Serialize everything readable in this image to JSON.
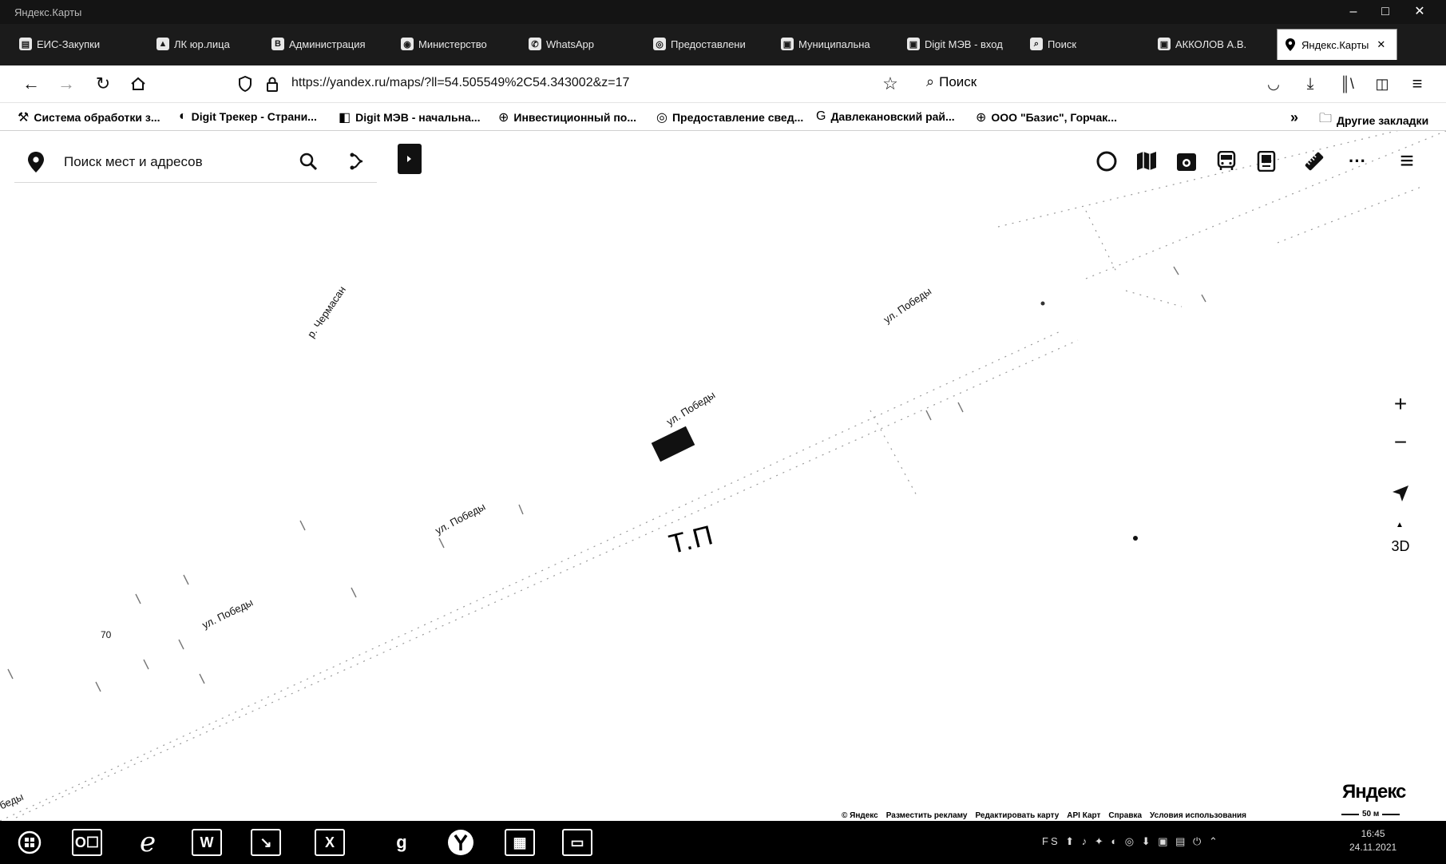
{
  "window": {
    "title": "Яндекс.Карты",
    "controls": [
      "–",
      "□",
      "✕"
    ]
  },
  "tabs": [
    {
      "label": "ЕИС-Закупки",
      "icon": "doc-icon"
    },
    {
      "label": "ЛК юр.лица",
      "icon": "doc-icon"
    },
    {
      "label": "Администрация",
      "icon": "vk-icon"
    },
    {
      "label": "Министерство",
      "icon": "globe-icon"
    },
    {
      "label": "WhatsApp",
      "icon": "whatsapp-icon"
    },
    {
      "label": "Предоставлени",
      "icon": "globe-icon"
    },
    {
      "label": "Муниципальна",
      "icon": "doc-icon"
    },
    {
      "label": "Digit МЭВ - вход",
      "icon": "doc-icon"
    },
    {
      "label": "Поиск",
      "icon": "search-icon"
    },
    {
      "label": "АККОЛОВ А.В.",
      "icon": "doc-icon"
    },
    {
      "label": "Яндекс.Карты",
      "icon": "map-pin-icon",
      "active": true,
      "close": "✕"
    }
  ],
  "navbar": {
    "url": "https://yandex.ru/maps/?ll=54.505549%2C54.343002&z=17",
    "search_label": "Поиск"
  },
  "bookmarks": [
    {
      "label": "Система обработки з...",
      "icon": "tool-icon"
    },
    {
      "label": "Digit Трекер - Страни...",
      "icon": "digit-icon"
    },
    {
      "label": "Digit МЭВ - начальна...",
      "icon": "digit-icon"
    },
    {
      "label": "Инвестиционный по...",
      "icon": "globe-icon"
    },
    {
      "label": "Предоставление свед...",
      "icon": "globe-icon"
    },
    {
      "label": "Давлекановский рай...",
      "icon": "google-icon"
    },
    {
      "label": "ООО \"Базис\", Горчак...",
      "icon": "globe-icon"
    }
  ],
  "bookmarks_more": "»",
  "bookmarks_other": "Другие закладки",
  "map": {
    "search_placeholder": "Поиск мест и адресов",
    "labels": {
      "river": "р. Чермасан",
      "street_1": "ул. Победы",
      "street_2": "ул. Победы",
      "street_3": "ул. Победы",
      "street_4": "ул. Победы",
      "street_5": "беды",
      "house_number": "70",
      "tp": "Т.П"
    },
    "zoom_in": "+",
    "zoom_out": "−",
    "btn_3d": "3D",
    "logo": "Яндекс",
    "footer_links": [
      "© Яндекс",
      "Разместить рекламу",
      "Редактировать карту",
      "API Карт",
      "Справка",
      "Условия использования"
    ],
    "scale": "50 м"
  },
  "taskbar": {
    "clock_time": "16:45",
    "clock_date": "24.11.2021",
    "tray": "FS ⬆ ♪ ✦ ◐ ◎ ⬇ ▣ ▤ ⏻ ⌃"
  }
}
